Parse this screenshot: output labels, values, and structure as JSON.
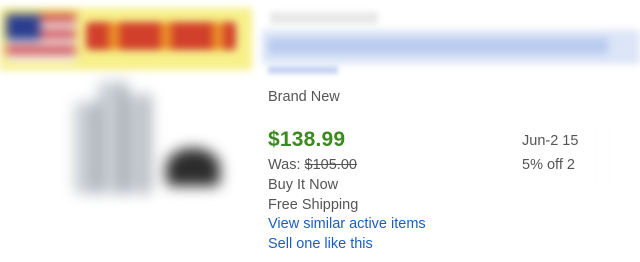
{
  "listing": {
    "condition": "Brand New",
    "price": "$138.99",
    "was_label": "Was:",
    "was_price": "$105.00",
    "buy_format": "Buy It Now",
    "shipping": "Free Shipping",
    "view_similar_link": "View similar active items",
    "sell_one_link": "Sell one like this",
    "end_date": "Jun-2 15",
    "discount": "5% off 2"
  },
  "colors": {
    "price": "#3a8a1f",
    "link": "#1a5fc0",
    "secondary_text": "#555555"
  }
}
